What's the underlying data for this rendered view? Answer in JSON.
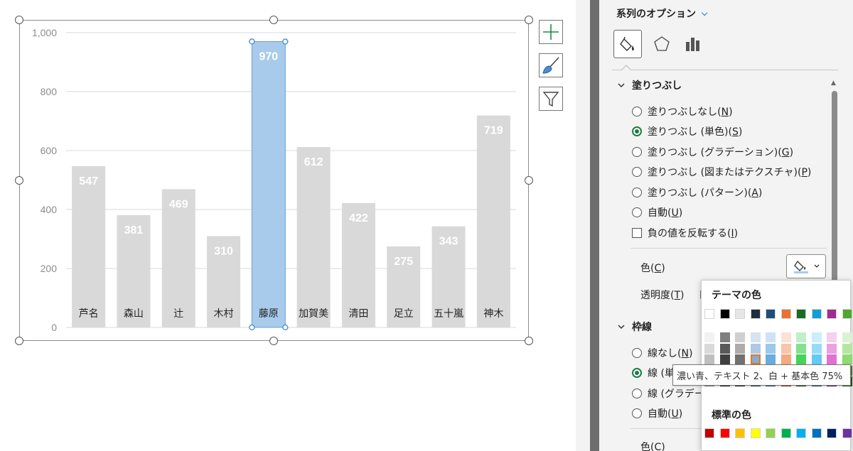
{
  "chart_data": {
    "type": "bar",
    "categories": [
      "芦名",
      "森山",
      "辻",
      "木村",
      "藤原",
      "加賀美",
      "清田",
      "足立",
      "五十嵐",
      "神木"
    ],
    "values": [
      547,
      381,
      469,
      310,
      970,
      612,
      422,
      275,
      343,
      719
    ],
    "data_labels": [
      "547",
      "381",
      "469",
      "310",
      "970",
      "612",
      "422",
      "275",
      "343",
      "719"
    ],
    "ylim": [
      0,
      1000
    ],
    "yticks": [
      0,
      200,
      400,
      600,
      800,
      1000
    ],
    "ytick_labels": [
      "0",
      "200",
      "400",
      "600",
      "800",
      "1,000"
    ],
    "title": "",
    "xlabel": "",
    "ylabel": "",
    "grid": true,
    "selected_index": 4,
    "colors": {
      "bar": "#d9d9d9",
      "selected_bar": "#a9cbeb",
      "label": "#ffffff",
      "category": "#222222",
      "grid": "#d9d9d9",
      "axis_text": "#8c8c8c"
    }
  },
  "chart_tools": [
    {
      "icon": "plus-icon",
      "name": "chart-elements-button"
    },
    {
      "icon": "brush-icon",
      "name": "chart-styles-button"
    },
    {
      "icon": "filter-icon",
      "name": "chart-filters-button"
    }
  ],
  "pane": {
    "title": "系列のオプション",
    "title_chevron": "⌵",
    "tabs": [
      {
        "icon": "fill-line-icon",
        "selected": true
      },
      {
        "icon": "effects-pentagon-icon",
        "selected": false
      },
      {
        "icon": "series-options-bars-icon",
        "selected": false
      }
    ],
    "fill_section": {
      "header": "塗りつぶし",
      "options": [
        {
          "label": "塗りつぶしなし",
          "key": "N",
          "checked": false
        },
        {
          "label": "塗りつぶし (単色)",
          "key": "S",
          "checked": true
        },
        {
          "label": "塗りつぶし (グラデーション)",
          "key": "G",
          "checked": false
        },
        {
          "label": "塗りつぶし (図またはテクスチャ)",
          "key": "P",
          "checked": false
        },
        {
          "label": "塗りつぶし (パターン)",
          "key": "A",
          "checked": false
        },
        {
          "label": "自動",
          "key": "U",
          "checked": false
        }
      ],
      "invert": {
        "label": "負の値を反転する",
        "key": "I",
        "checked": false
      },
      "color_label": "色",
      "color_key": "C",
      "transparency_label": "透明度",
      "transparency_key": "T",
      "transparency_partial": "ト"
    },
    "border_section": {
      "header": "枠線",
      "options": [
        {
          "label": "線なし",
          "key": "N",
          "checked": false
        },
        {
          "label": "線 (単",
          "checked": true
        },
        {
          "label": "線 (グラデー",
          "checked": false
        },
        {
          "label": "自動",
          "key": "U",
          "checked": false
        }
      ],
      "color_label": "色",
      "color_key": "C"
    }
  },
  "color_popup": {
    "theme_header": "テーマの色",
    "standard_header": "標準の色",
    "theme_top": [
      "#ffffff",
      "#000000",
      "#e7e6e6",
      "#1f2d3d",
      "#1f4e79",
      "#e97132",
      "#196b24",
      "#0f9ed5",
      "#a02b93",
      "#4ea72e"
    ],
    "theme_shades": [
      [
        "#f2f2f2",
        "#d9d9d9",
        "#bfbfbf",
        "#a6a6a6",
        "#7f7f7f"
      ],
      [
        "#7f7f7f",
        "#595959",
        "#3f3f3f",
        "#262626",
        "#0d0d0d"
      ],
      [
        "#d0cece",
        "#afabab",
        "#757070",
        "#3a3838",
        "#171616"
      ],
      [
        "#d6e3f1",
        "#aec9e4",
        "#85acd7",
        "#3f6f9f",
        "#1f3a57"
      ],
      [
        "#cde3f5",
        "#9bc8eb",
        "#69acdf",
        "#2c77b8",
        "#184777"
      ],
      [
        "#fbe2d5",
        "#f7c6ab",
        "#f3a982",
        "#c55a17",
        "#83380f"
      ],
      [
        "#c1f0c8",
        "#83e28e",
        "#45d35a",
        "#124f1b",
        "#0c3512"
      ],
      [
        "#cbeefb",
        "#97dcf7",
        "#63caf3",
        "#0b76a0",
        "#074f6a"
      ],
      [
        "#f5d0ef",
        "#eba1e0",
        "#e172d0",
        "#782070",
        "#50154a"
      ],
      [
        "#daf2d0",
        "#b5e6a2",
        "#8fda73",
        "#3a7d22",
        "#275317"
      ]
    ],
    "highlighted": {
      "column": 3,
      "row": 2
    },
    "standard": [
      "#c00000",
      "#ff0000",
      "#ffc000",
      "#ffff00",
      "#92d050",
      "#00b050",
      "#00b0f0",
      "#0070c0",
      "#002060",
      "#7030a0"
    ],
    "tooltip": "濃い青、テキスト 2、白 + 基本色 75%"
  }
}
